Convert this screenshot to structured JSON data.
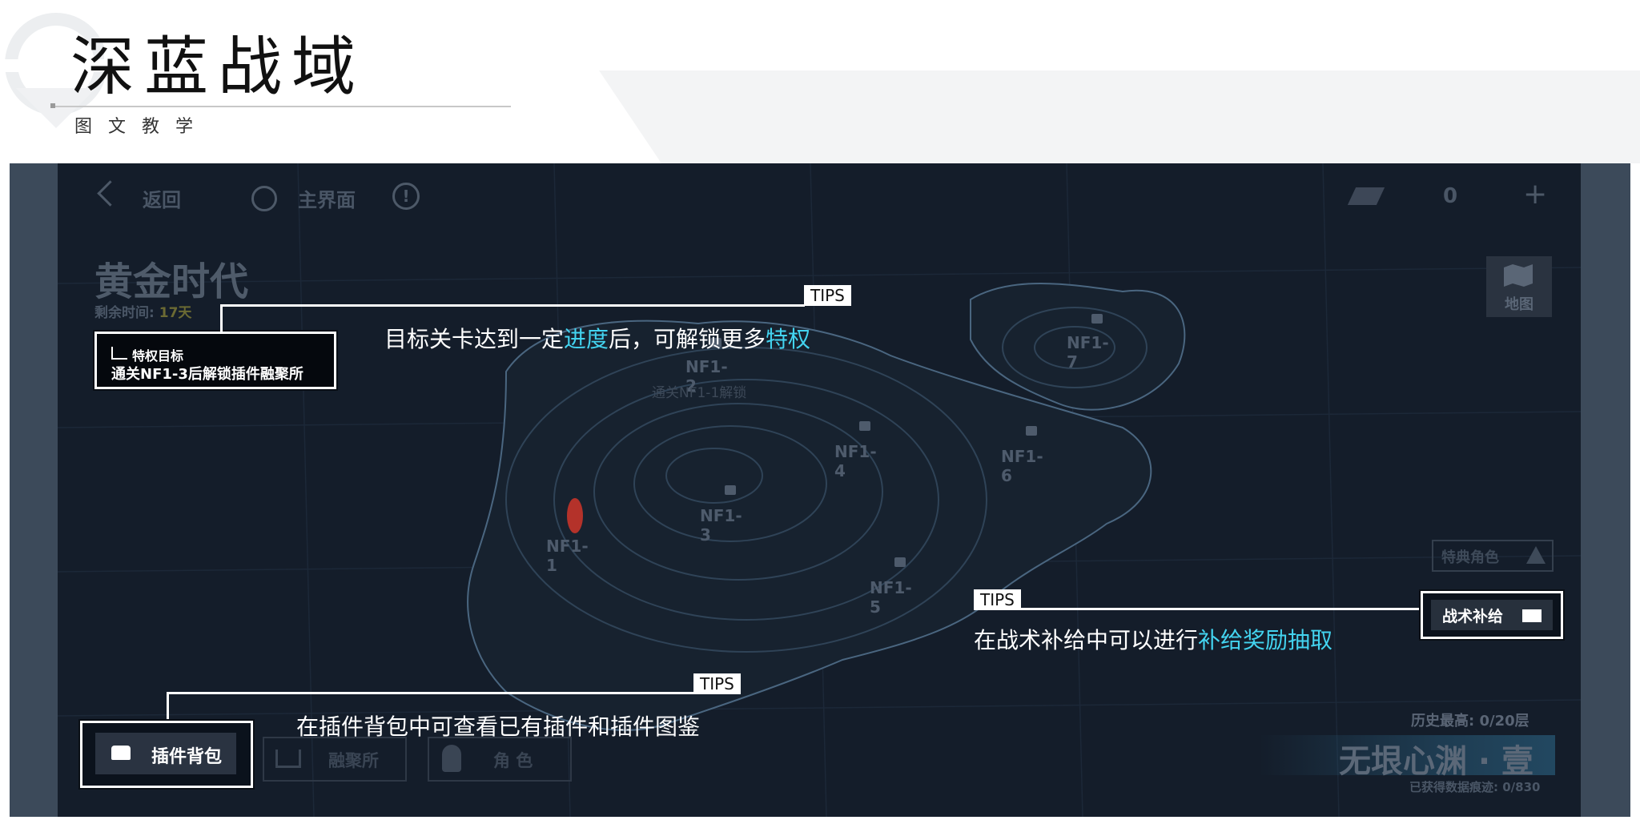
{
  "header": {
    "title": "深蓝战域",
    "subtitle": "图文教学"
  },
  "topbar": {
    "back_label": "返回",
    "home_label": "主界面",
    "info_icon": "!",
    "currency_value": "0",
    "add_icon": "+"
  },
  "event": {
    "title": "黄金时代",
    "remaining_label": "剩余时间:",
    "remaining_value": "17天"
  },
  "map_button": {
    "label": "地图",
    "icon": "map-icon"
  },
  "privilege": {
    "heading": "特权目标",
    "desc": "通关NF1-3后解锁插件融聚所"
  },
  "stages": [
    {
      "id": "NF1-1"
    },
    {
      "id": "NF1-2",
      "note": "通关NF1-1解锁"
    },
    {
      "id": "NF1-3"
    },
    {
      "id": "NF1-4"
    },
    {
      "id": "NF1-5"
    },
    {
      "id": "NF1-6"
    },
    {
      "id": "NF1-7"
    }
  ],
  "tips": [
    {
      "tag": "TIPS",
      "text_parts": [
        "目标关卡达到一定",
        "进度",
        "后，可解锁更多",
        "特权"
      ]
    },
    {
      "tag": "TIPS",
      "text_parts": [
        "在战术补给中可以进行",
        "补给奖励抽取"
      ]
    },
    {
      "tag": "TIPS",
      "text": "在插件背包中可查看已有插件和插件图鉴"
    }
  ],
  "supply_button": {
    "label": "战术补给"
  },
  "exclusive_role": {
    "label": "特典角色"
  },
  "bottom_buttons": {
    "bag": "插件背包",
    "fusion": "融聚所",
    "role": "角 色"
  },
  "abyss": {
    "best": "历史最高: 0/20层",
    "name": "无垠心渊 · 壹",
    "records": "已获得数据痕迹: 0/830"
  },
  "colors": {
    "highlight": "#43d4f0",
    "screen_bg": "#141d2a",
    "frame": "#3c4a5a"
  }
}
